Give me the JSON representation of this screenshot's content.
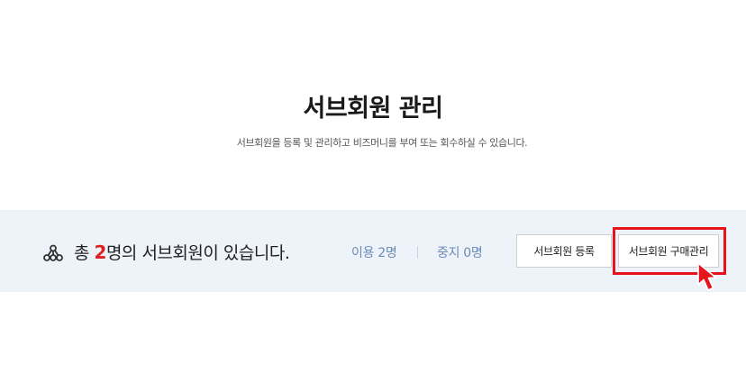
{
  "header": {
    "title": "서브회원 관리",
    "description": "서브회원을 등록 및 관리하고 비즈머니를 부여 또는 회수하실 수 있습니다."
  },
  "summary": {
    "icon": "org-chart-icon",
    "prefix": "총 ",
    "count": "2",
    "suffix": "명의 서브회원이 있습니다.",
    "active_label": "이용 2명",
    "paused_label": "중지 0명"
  },
  "actions": {
    "register_label": "서브회원 등록",
    "purchase_label": "서브회원 구매관리"
  },
  "colors": {
    "accent_red": "#e02020",
    "highlight": "#e8141c",
    "bar_bg": "#eef3fa",
    "stat_text": "#6b8bb5"
  }
}
